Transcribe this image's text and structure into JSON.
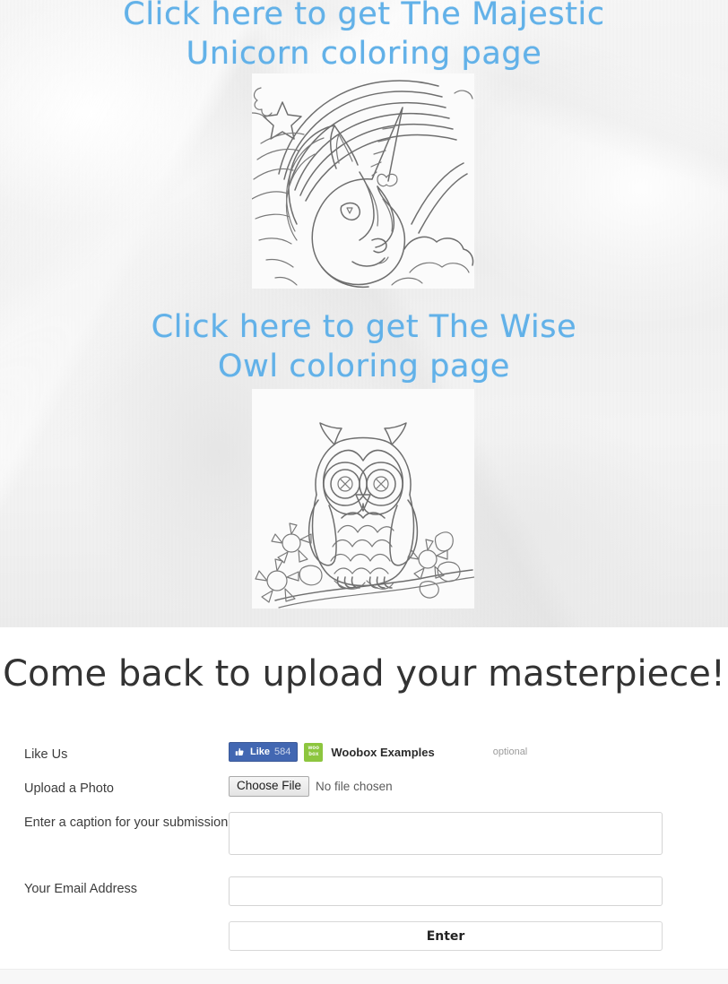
{
  "hero": {
    "unicorn_promo": {
      "line1": "Click here to get The Majestic",
      "line2": "Unicorn coloring page",
      "thumbnail_name": "majestic-unicorn-coloring-page",
      "text_color": "#62b1e8"
    },
    "owl_promo": {
      "line1": "Click here to get The Wise",
      "line2": "Owl coloring page",
      "thumbnail_name": "wise-owl-coloring-page",
      "text_color": "#62b1e8"
    }
  },
  "panel": {
    "title": "Come back to upload your masterpiece!"
  },
  "form": {
    "like": {
      "label": "Like Us",
      "fb_button_text": "Like",
      "fb_like_count": "584",
      "fb_icon": "thumbs-up-icon",
      "fb_color": "#4267b2",
      "woobox_logo_line1": "woo",
      "woobox_logo_line2": "box",
      "woobox_color": "#8dc63f",
      "page_name": "Woobox Examples",
      "optional_note": "optional"
    },
    "upload": {
      "label": "Upload a Photo",
      "button_text": "Choose File",
      "file_status": "No file chosen"
    },
    "caption": {
      "label": "Enter a caption for your submission",
      "value": "",
      "placeholder": ""
    },
    "email": {
      "label": "Your Email Address",
      "value": "",
      "placeholder": ""
    },
    "submit": {
      "label": "Enter"
    }
  }
}
